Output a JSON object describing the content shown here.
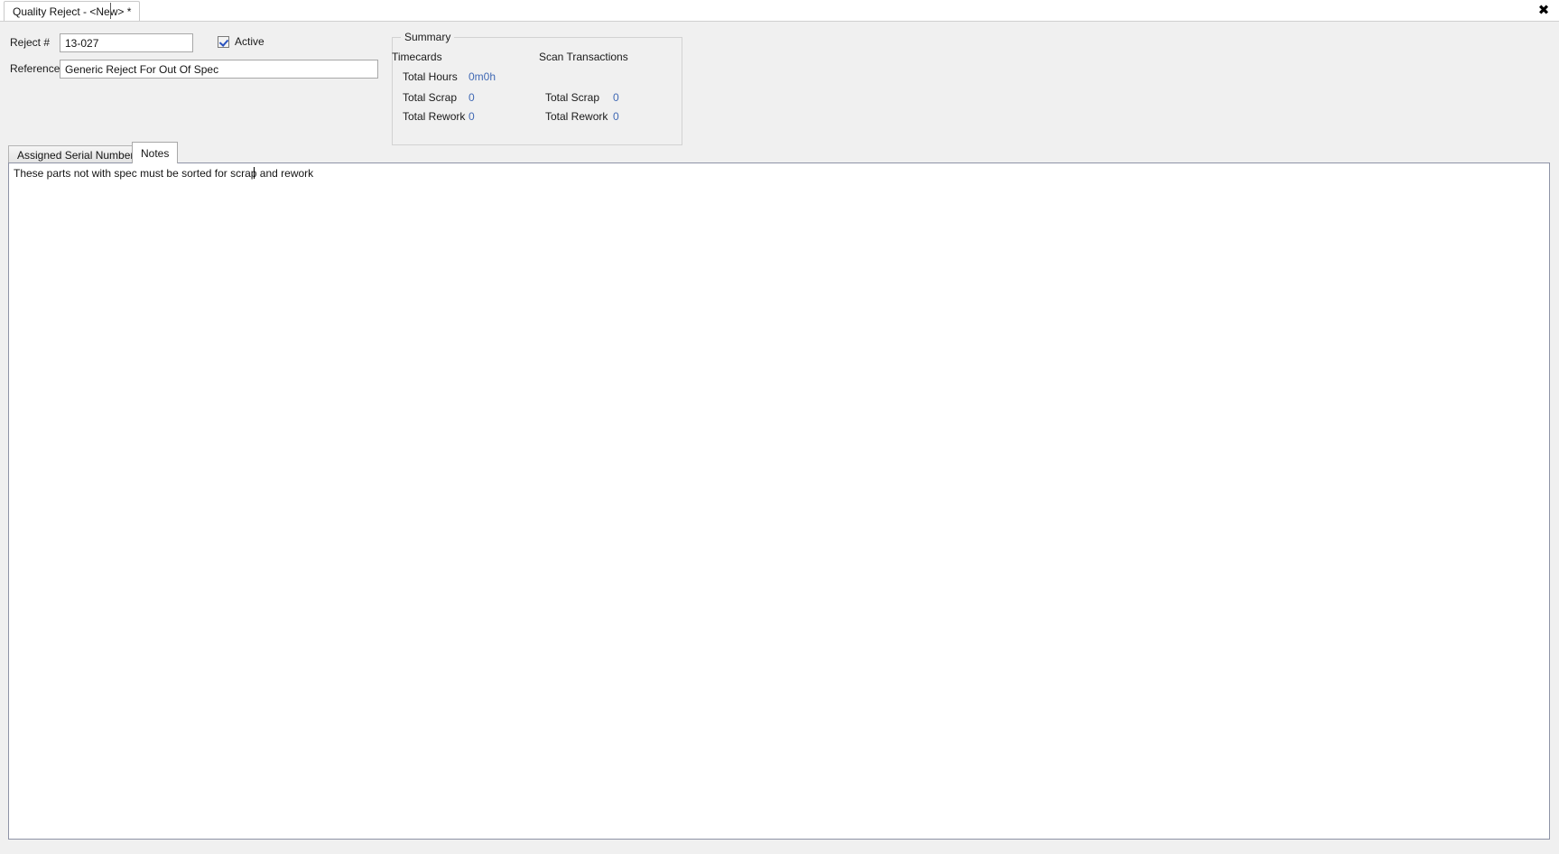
{
  "window": {
    "tab_title": "Quality Reject - <New> *",
    "close_label": "✖"
  },
  "form": {
    "reject_number_label": "Reject #",
    "reject_number_value": "13-027",
    "reference_label": "Reference",
    "reference_value": "Generic Reject For Out Of Spec",
    "active_label": "Active",
    "active_checked": true
  },
  "summary": {
    "title": "Summary",
    "timecards_header": "Timecards",
    "scan_transactions_header": "Scan Transactions",
    "timecards": {
      "total_hours_label": "Total Hours",
      "total_hours_value": "0m0h",
      "total_scrap_label": "Total Scrap",
      "total_scrap_value": "0",
      "total_rework_label": "Total Rework",
      "total_rework_value": "0"
    },
    "scan_transactions": {
      "total_scrap_label": "Total Scrap",
      "total_scrap_value": "0",
      "total_rework_label": "Total Rework",
      "total_rework_value": "0"
    },
    "value_color": "#4169b4"
  },
  "tabs": {
    "items": [
      {
        "label": "Assigned Serial Numbers",
        "active": false
      },
      {
        "label": "Notes",
        "active": true
      }
    ]
  },
  "notes": {
    "text": "These parts not with spec must be sorted for scrap and rework"
  }
}
